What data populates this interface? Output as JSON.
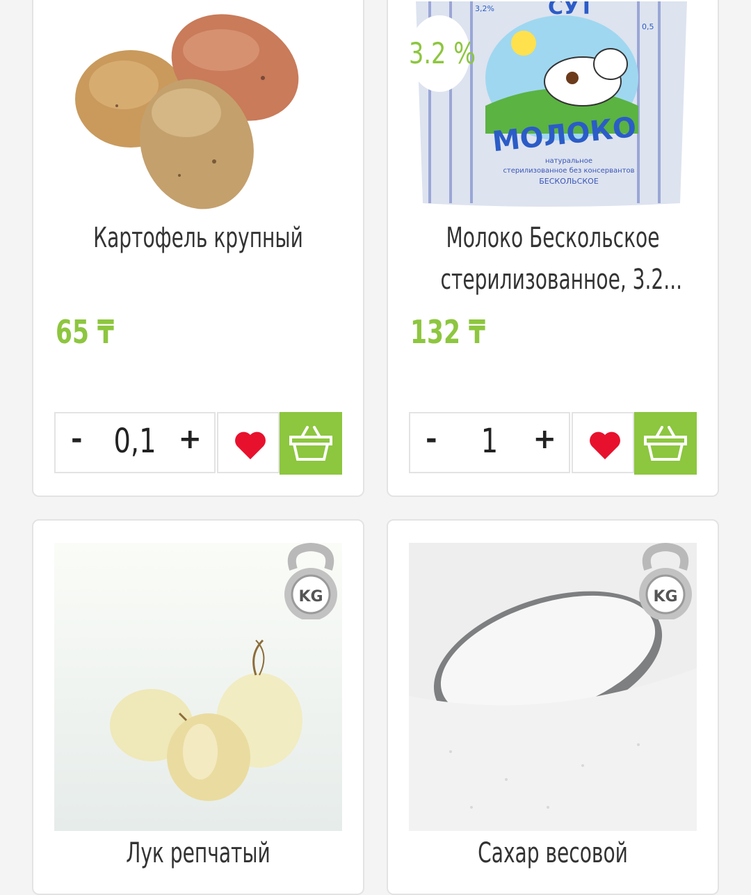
{
  "products": [
    {
      "title_lines": [
        "Картофель крупный"
      ],
      "price": "65 ₸",
      "quantity": "0,1"
    },
    {
      "title_lines": [
        "Молоко Бескольское",
        "стерилизованное, 3.2..."
      ],
      "price": "132 ₸",
      "quantity": "1",
      "badge": "3.2 %",
      "package_text": {
        "brand": "СУТ",
        "name": "МОЛОКО",
        "line1": "натуральное",
        "line2": "стерилизованное без консервантов",
        "line3": "БЕСКОЛЬСКОЕ",
        "fat_left": "3,2%",
        "volume": "0,5"
      }
    },
    {
      "title_lines": [
        "Лук репчатый"
      ],
      "kg_label": "KG"
    },
    {
      "title_lines": [
        "Сахар весовой"
      ],
      "kg_label": "KG"
    }
  ],
  "controls": {
    "minus": "-",
    "plus": "+"
  },
  "icons": {
    "favorite": "heart-icon",
    "cart": "basket-icon",
    "weight": "kettlebell-kg-icon"
  },
  "colors": {
    "accent": "#8dc63f",
    "heart": "#e8112d",
    "text": "#333333",
    "border": "#e3e3e3"
  }
}
